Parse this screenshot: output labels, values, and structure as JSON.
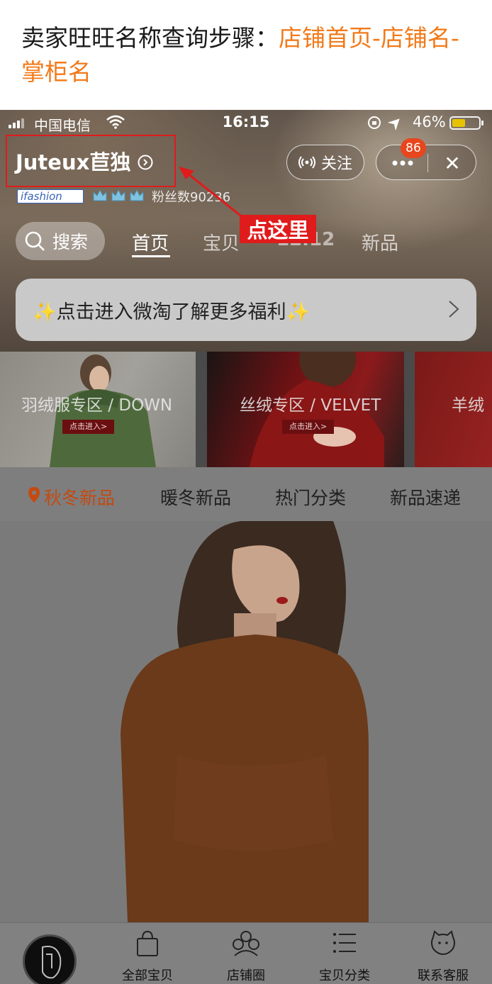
{
  "instruction": {
    "prefix": "卖家旺旺名称查询步骤：",
    "steps": "店铺首页-店铺名-",
    "line2": "掌柜名"
  },
  "status_bar": {
    "carrier": "中国电信",
    "time": "16:15",
    "battery": "46%"
  },
  "shop": {
    "name": "Juteux苣独",
    "follow_label": "关注",
    "badge_count": "86",
    "close_label": "✕",
    "ifashion_label": "ifashion",
    "fans_label": "粉丝数90236"
  },
  "annotation": {
    "callout_label": "点这里"
  },
  "tabs": {
    "search_label": "搜索",
    "items": [
      "首页",
      "宝贝",
      "12.12",
      "新品"
    ]
  },
  "promo": {
    "text": "✨点击进入微淘了解更多福利✨"
  },
  "tiles": [
    {
      "label": "羽绒服专区 / DOWN",
      "button": "点击进入>"
    },
    {
      "label": "丝绒专区 / VELVET",
      "button": "点击进入>"
    },
    {
      "label": "羊绒"
    }
  ],
  "category_nav": [
    "秋冬新品",
    "暖冬新品",
    "热门分类",
    "新品速递"
  ],
  "bottom_bar": {
    "items": [
      "全部宝贝",
      "店铺圈",
      "宝贝分类",
      "联系客服"
    ]
  },
  "colors": {
    "accent_orange": "#f27a1a",
    "callout_red": "#e01b1b",
    "category_active": "#c44a12",
    "badge": "#e8461c"
  }
}
